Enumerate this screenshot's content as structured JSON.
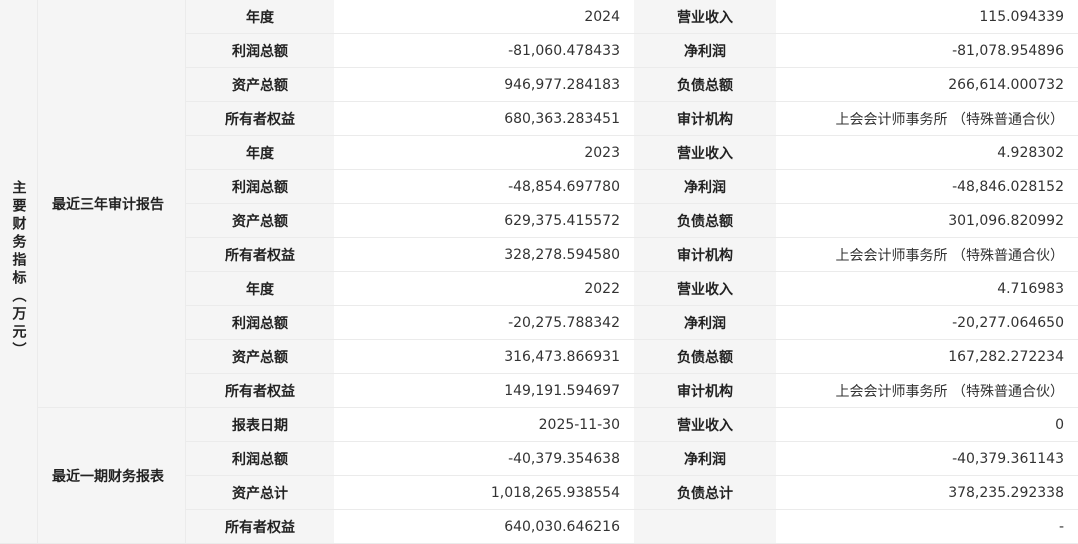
{
  "category": "主要财务指标（万元）",
  "sections": [
    {
      "title": "最近三年审计报告",
      "rows": [
        {
          "l1": "年度",
          "v1": "2024",
          "l2": "营业收入",
          "v2": "115.094339"
        },
        {
          "l1": "利润总额",
          "v1": "-81,060.478433",
          "l2": "净利润",
          "v2": "-81,078.954896"
        },
        {
          "l1": "资产总额",
          "v1": "946,977.284183",
          "l2": "负债总额",
          "v2": "266,614.000732"
        },
        {
          "l1": "所有者权益",
          "v1": "680,363.283451",
          "l2": "审计机构",
          "v2": "上会会计师事务所 （特殊普通合伙）"
        },
        {
          "l1": "年度",
          "v1": "2023",
          "l2": "营业收入",
          "v2": "4.928302"
        },
        {
          "l1": "利润总额",
          "v1": "-48,854.697780",
          "l2": "净利润",
          "v2": "-48,846.028152"
        },
        {
          "l1": "资产总额",
          "v1": "629,375.415572",
          "l2": "负债总额",
          "v2": "301,096.820992"
        },
        {
          "l1": "所有者权益",
          "v1": "328,278.594580",
          "l2": "审计机构",
          "v2": "上会会计师事务所 （特殊普通合伙）"
        },
        {
          "l1": "年度",
          "v1": "2022",
          "l2": "营业收入",
          "v2": "4.716983"
        },
        {
          "l1": "利润总额",
          "v1": "-20,275.788342",
          "l2": "净利润",
          "v2": "-20,277.064650"
        },
        {
          "l1": "资产总额",
          "v1": "316,473.866931",
          "l2": "负债总额",
          "v2": "167,282.272234"
        },
        {
          "l1": "所有者权益",
          "v1": "149,191.594697",
          "l2": "审计机构",
          "v2": "上会会计师事务所 （特殊普通合伙）"
        }
      ]
    },
    {
      "title": "最近一期财务报表",
      "rows": [
        {
          "l1": "报表日期",
          "v1": "2025-11-30",
          "l2": "营业收入",
          "v2": "0"
        },
        {
          "l1": "利润总额",
          "v1": "-40,379.354638",
          "l2": "净利润",
          "v2": "-40,379.361143"
        },
        {
          "l1": "资产总计",
          "v1": "1,018,265.938554",
          "l2": "负债总计",
          "v2": "378,235.292338"
        },
        {
          "l1": "所有者权益",
          "v1": "640,030.646216",
          "l2": "",
          "v2": "-"
        }
      ]
    }
  ]
}
